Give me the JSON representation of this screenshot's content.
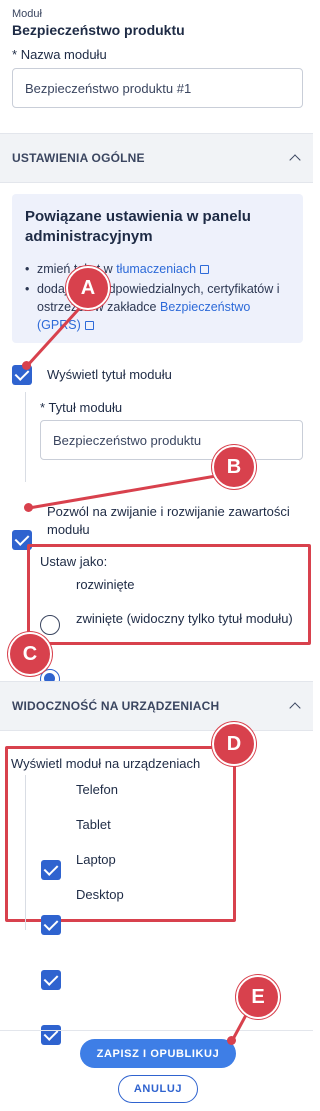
{
  "header": {
    "module_caption": "Moduł",
    "module_title": "Bezpieczeństwo produktu",
    "name_required": "*",
    "name_label": "Nazwa modułu",
    "name_value": "Bezpieczeństwo produktu #1"
  },
  "general_settings": {
    "heading": "USTAWIENIA OGÓLNE",
    "info": {
      "title": "Powiązane ustawienia w panelu administracyjnym",
      "item1_prefix": "zmień tekst w ",
      "item1_link": "tłumaczeniach",
      "item2_prefix": "dodaj osób odpowiedzialnych, certyfikatów i ostrzeżeń w zakładce ",
      "item2_link": "Bezpieczeństwo (GPRS)"
    },
    "show_title": {
      "label": "Wyświetl tytuł modułu",
      "checked": true
    },
    "title_required": "*",
    "title_label": "Tytuł modułu",
    "title_value": "Bezpieczeństwo produktu",
    "collapse": {
      "label": "Pozwól na zwijanie i rozwijanie zawartości modułu",
      "checked": true
    },
    "set_as_label": "Ustaw jako:",
    "options": [
      {
        "label": "rozwinięte",
        "selected": false
      },
      {
        "label": "zwinięte (widoczny tylko tytuł modułu)",
        "selected": true
      }
    ]
  },
  "visibility": {
    "heading": "WIDOCZNOŚĆ NA URZĄDZENIACH",
    "devices_label": "Wyświetl moduł na urządzeniach",
    "devices": [
      {
        "label": "Telefon",
        "checked": true
      },
      {
        "label": "Tablet",
        "checked": true
      },
      {
        "label": "Laptop",
        "checked": true
      },
      {
        "label": "Desktop",
        "checked": true
      }
    ]
  },
  "footer": {
    "save_label": "ZAPISZ I OPUBLIKUJ",
    "cancel_label": "ANULUJ"
  },
  "annotations": {
    "a": "A",
    "b": "B",
    "c": "C",
    "d": "D",
    "e": "E"
  },
  "colors": {
    "accent": "#2f63cf",
    "annotation_red": "#d8414d",
    "primary_button": "#3e7ee6"
  }
}
